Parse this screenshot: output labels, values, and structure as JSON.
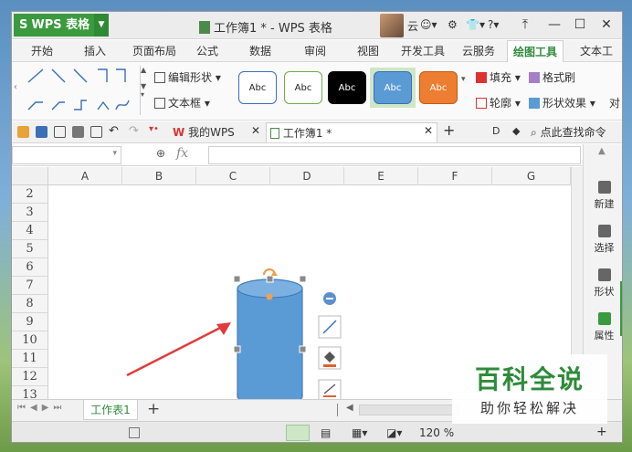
{
  "titlebar": {
    "app_name": "WPS 表格",
    "doc_title": "工作簿1 * - WPS 表格",
    "cloud_label": "云"
  },
  "menu": {
    "items": [
      "开始",
      "插入",
      "页面布局",
      "公式",
      "数据",
      "审阅",
      "视图",
      "开发工具",
      "云服务",
      "绘图工具",
      "文本工"
    ],
    "active": "绘图工具"
  },
  "ribbon": {
    "edit_shape": "编辑形状",
    "text_box": "文本框",
    "style_label": "Abc",
    "style_colors": [
      "#ffffff",
      "#ffffff",
      "#000000",
      "#5b9bd5",
      "#ed7d31"
    ],
    "fill": "填充",
    "format_painter": "格式刷",
    "outline": "轮廓",
    "shape_effects": "形状效果",
    "cut_label": "对"
  },
  "doc_tabs": {
    "my_wps": "我的WPS",
    "workbook": "工作簿1 *",
    "search": "点此查找命令"
  },
  "formula_bar": {
    "fx": "fx"
  },
  "grid": {
    "columns": [
      "A",
      "B",
      "C",
      "D",
      "E",
      "F",
      "G"
    ],
    "rows": [
      "2",
      "3",
      "4",
      "5",
      "6",
      "7",
      "8",
      "9",
      "10",
      "11",
      "12",
      "13"
    ]
  },
  "side_panel": {
    "items": [
      "新建",
      "选择",
      "形状",
      "属性"
    ]
  },
  "sheet": {
    "tab": "工作表1"
  },
  "status": {
    "zoom": "120 %"
  },
  "watermark": {
    "title": "百科全说",
    "subtitle": "助你轻松解决"
  },
  "colors": {
    "accent": "#2e8b3a",
    "shape_fill": "#5b9bd5",
    "arrow": "#e03c3c"
  }
}
